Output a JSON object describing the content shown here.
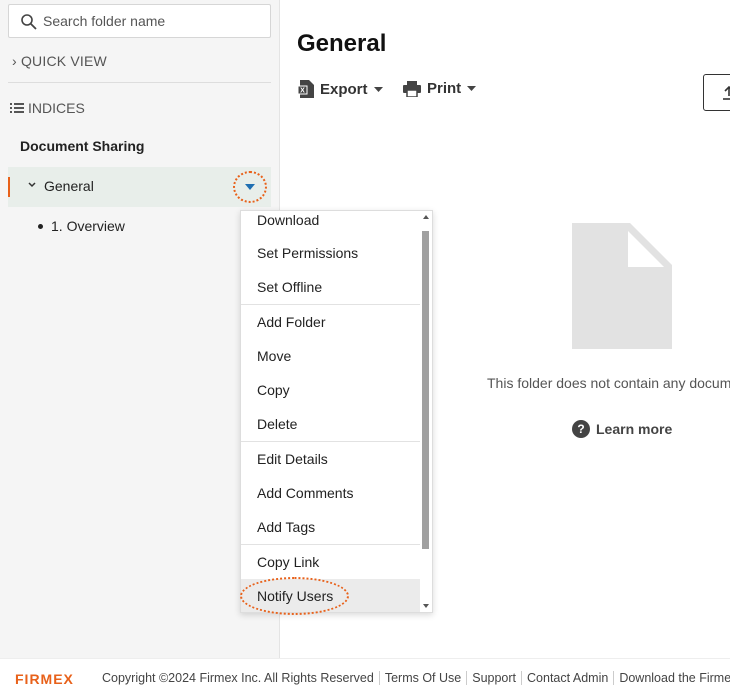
{
  "sidebar": {
    "search_placeholder": "Search folder name",
    "quick_view": "QUICK VIEW",
    "indices": "INDICES",
    "section_title": "Document Sharing",
    "folder": {
      "label": "General"
    },
    "subitem": "1. Overview"
  },
  "main": {
    "title": "General",
    "export_label": "Export",
    "print_label": "Print",
    "empty_text": "This folder does not contain any docum",
    "learn_more": "Learn more"
  },
  "context_menu": {
    "items": [
      "Download",
      "Set Permissions",
      "Set Offline",
      "Add Folder",
      "Move",
      "Copy",
      "Delete",
      "Edit Details",
      "Add Comments",
      "Add Tags",
      "Copy Link",
      "Notify Users"
    ],
    "highlighted": "Notify Users"
  },
  "footer": {
    "logo": "FIRMEX",
    "links": [
      "Copyright ©2024 Firmex Inc. All Rights Reserved",
      "Terms Of Use",
      "Support",
      "Contact Admin",
      "Download the Firmex Plu"
    ]
  },
  "colors": {
    "accent": "#e8611a",
    "selected_row": "#e8eeea"
  }
}
